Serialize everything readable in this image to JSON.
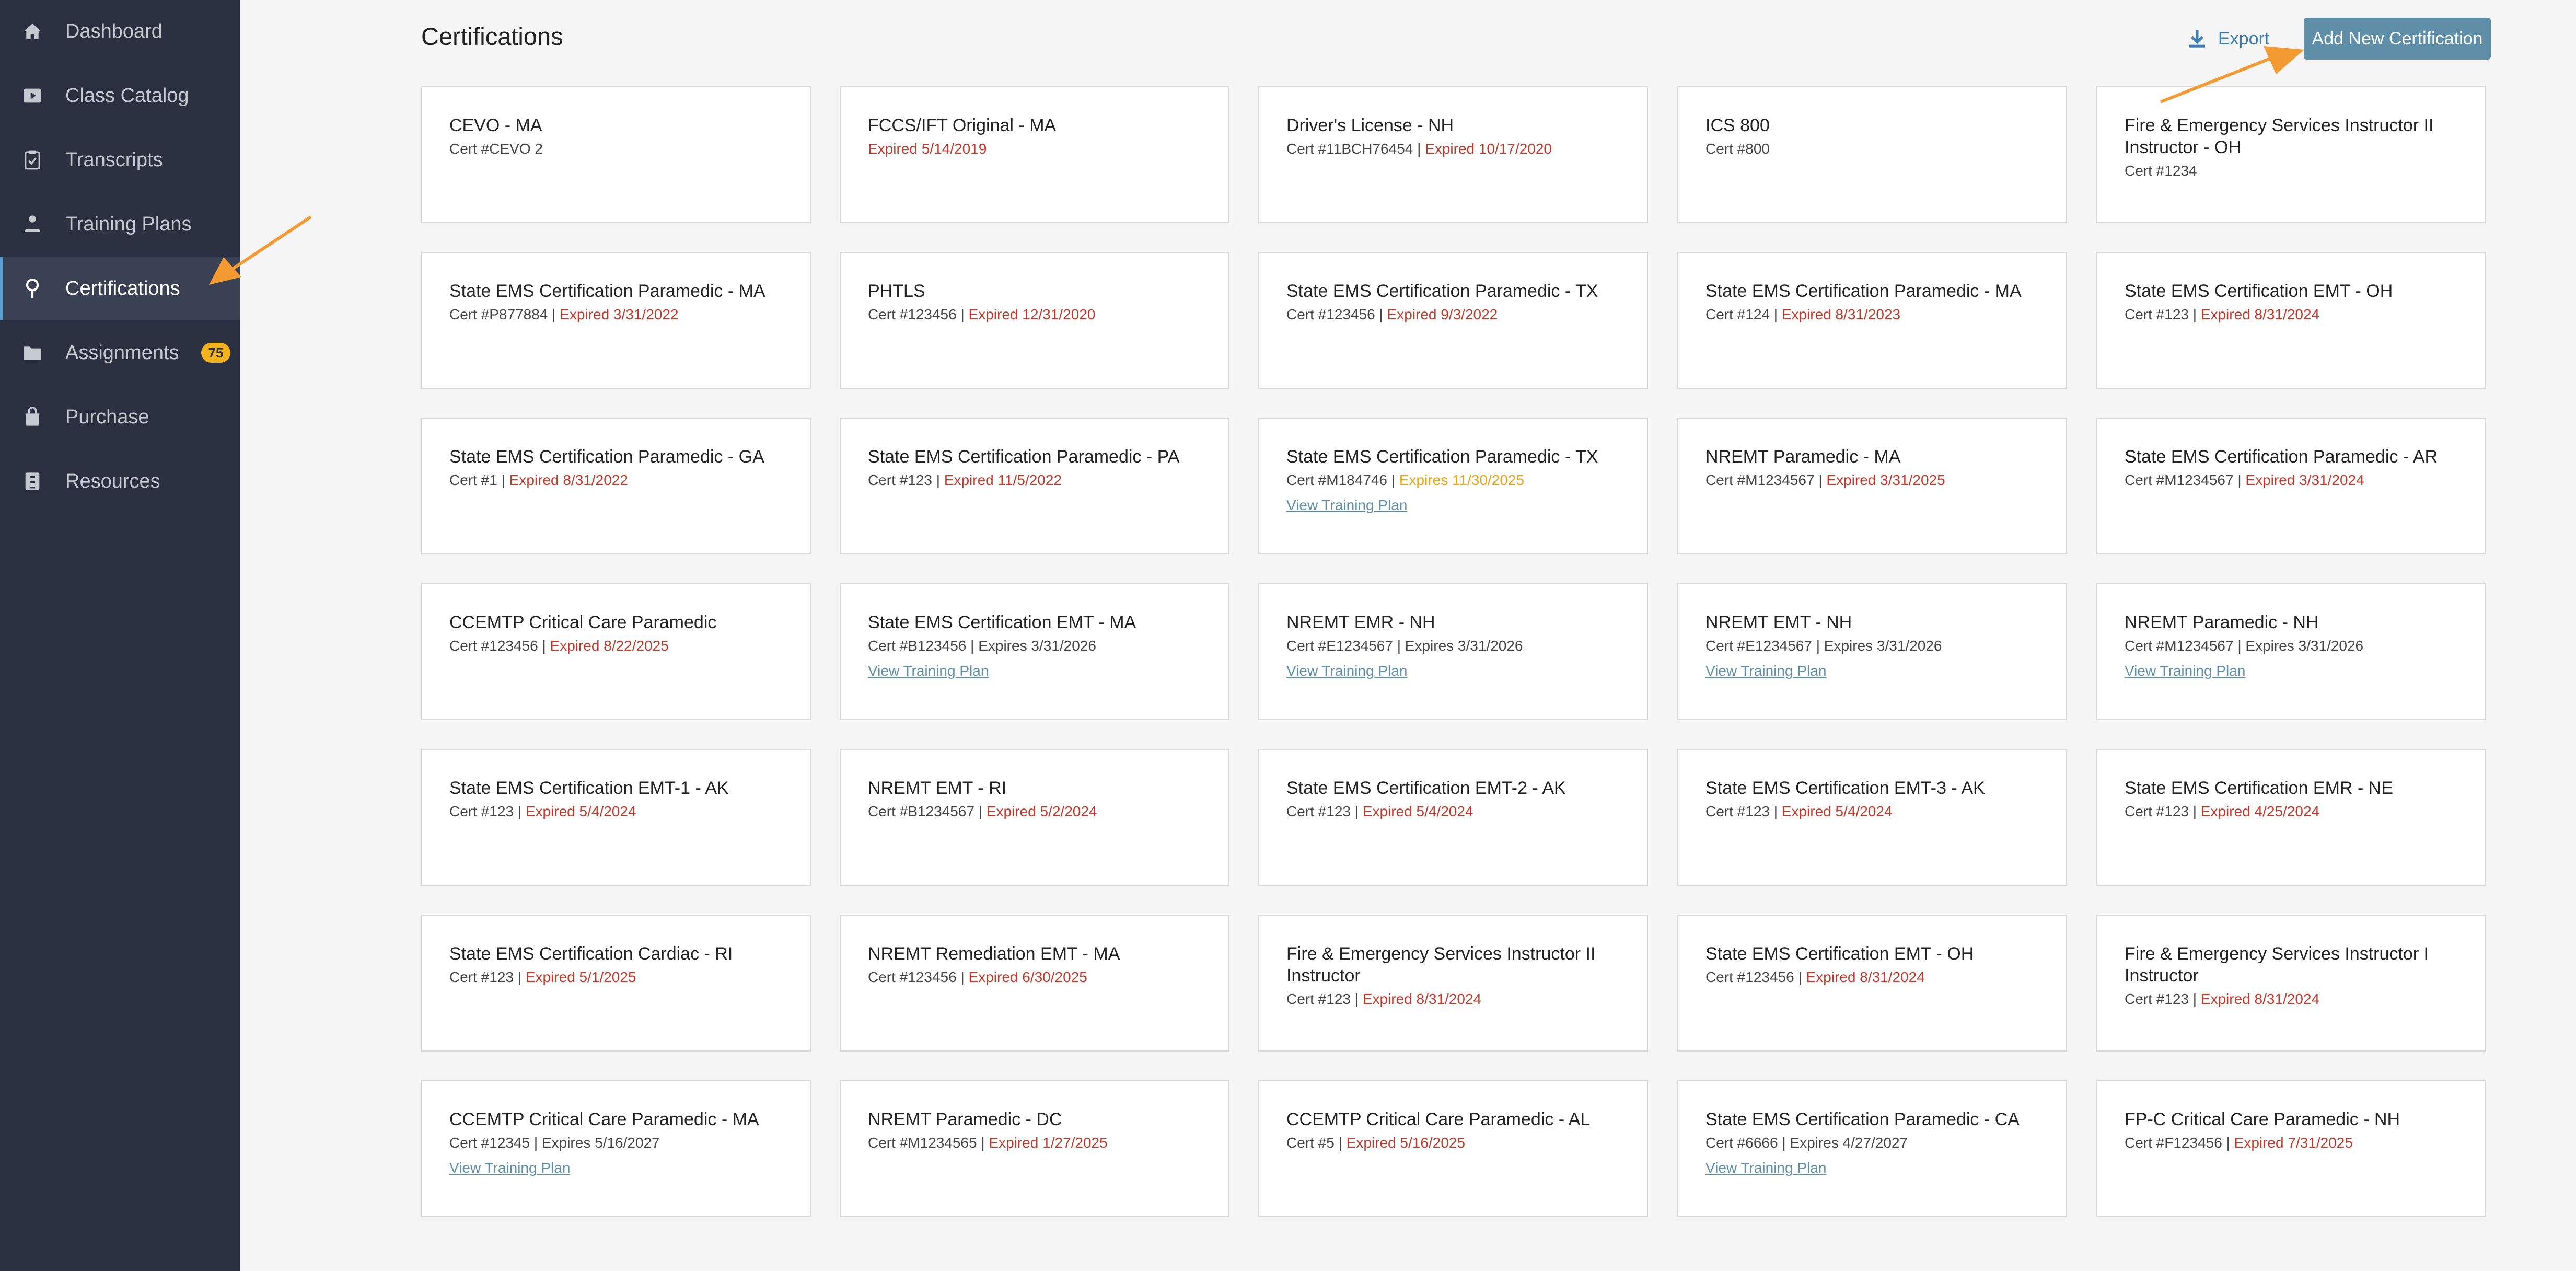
{
  "sidebar": {
    "items": [
      {
        "label": "Dashboard",
        "icon": "home-icon"
      },
      {
        "label": "Class Catalog",
        "icon": "play-icon"
      },
      {
        "label": "Transcripts",
        "icon": "clipboard-check-icon"
      },
      {
        "label": "Training Plans",
        "icon": "person-icon"
      },
      {
        "label": "Certifications",
        "icon": "ribbon-icon",
        "active": true
      },
      {
        "label": "Assignments",
        "icon": "folder-icon",
        "badge": "75"
      },
      {
        "label": "Purchase",
        "icon": "shopping-bag-icon"
      },
      {
        "label": "Resources",
        "icon": "cabinet-icon"
      }
    ]
  },
  "header": {
    "title": "Certifications",
    "export_label": "Export",
    "add_label": "Add New Certification"
  },
  "colors": {
    "sidebar_bg": "#2b3040",
    "active_item_bg": "#3a4152",
    "accent": "#5f8fa8",
    "expired": "#c0392b",
    "expiring_soon": "#e8a317",
    "badge": "#f2b21c",
    "annotation_arrow": "#f39a33"
  },
  "certifications": [
    {
      "title": "CEVO - MA",
      "cert": "Cert #CEVO 2",
      "status": "",
      "status_type": "none",
      "link": ""
    },
    {
      "title": "FCCS/IFT Original - MA",
      "cert": "",
      "status": "Expired 5/14/2019",
      "status_type": "expired",
      "link": ""
    },
    {
      "title": "Driver's License - NH",
      "cert": "Cert #11BCH76454",
      "status": "Expired 10/17/2020",
      "status_type": "expired",
      "link": ""
    },
    {
      "title": "ICS 800",
      "cert": "Cert #800",
      "status": "",
      "status_type": "none",
      "link": ""
    },
    {
      "title": "Fire & Emergency Services Instructor II Instructor - OH",
      "cert": "Cert #1234",
      "status": "",
      "status_type": "none",
      "link": ""
    },
    {
      "title": "State EMS Certification Paramedic - MA",
      "cert": "Cert #P877884",
      "status": "Expired 3/31/2022",
      "status_type": "expired",
      "link": ""
    },
    {
      "title": "PHTLS",
      "cert": "Cert #123456",
      "status": "Expired 12/31/2020",
      "status_type": "expired",
      "link": ""
    },
    {
      "title": "State EMS Certification Paramedic - TX",
      "cert": "Cert #123456",
      "status": "Expired 9/3/2022",
      "status_type": "expired",
      "link": ""
    },
    {
      "title": "State EMS Certification Paramedic - MA",
      "cert": "Cert #124",
      "status": "Expired 8/31/2023",
      "status_type": "expired",
      "link": ""
    },
    {
      "title": "State EMS Certification EMT - OH",
      "cert": "Cert #123",
      "status": "Expired 8/31/2024",
      "status_type": "expired",
      "link": ""
    },
    {
      "title": "State EMS Certification Paramedic - GA",
      "cert": "Cert #1",
      "status": "Expired 8/31/2022",
      "status_type": "expired",
      "link": ""
    },
    {
      "title": "State EMS Certification Paramedic - PA",
      "cert": "Cert #123",
      "status": "Expired 11/5/2022",
      "status_type": "expired",
      "link": ""
    },
    {
      "title": "State EMS Certification Paramedic - TX",
      "cert": "Cert #M184746",
      "status": "Expires 11/30/2025",
      "status_type": "soon",
      "link": "View Training Plan"
    },
    {
      "title": "NREMT Paramedic - MA",
      "cert": "Cert #M1234567",
      "status": "Expired 3/31/2025",
      "status_type": "expired",
      "link": ""
    },
    {
      "title": "State EMS Certification Paramedic - AR",
      "cert": "Cert #M1234567",
      "status": "Expired 3/31/2024",
      "status_type": "expired",
      "link": ""
    },
    {
      "title": "CCEMTP Critical Care Paramedic",
      "cert": "Cert #123456",
      "status": "Expired 8/22/2025",
      "status_type": "expired",
      "link": ""
    },
    {
      "title": "State EMS Certification EMT - MA",
      "cert": "Cert #B123456",
      "status": "Expires 3/31/2026",
      "status_type": "ok",
      "link": "View Training Plan"
    },
    {
      "title": "NREMT EMR - NH",
      "cert": "Cert #E1234567",
      "status": "Expires 3/31/2026",
      "status_type": "ok",
      "link": "View Training Plan"
    },
    {
      "title": "NREMT EMT - NH",
      "cert": "Cert #E1234567",
      "status": "Expires 3/31/2026",
      "status_type": "ok",
      "link": "View Training Plan"
    },
    {
      "title": "NREMT Paramedic - NH",
      "cert": "Cert #M1234567",
      "status": "Expires 3/31/2026",
      "status_type": "ok",
      "link": "View Training Plan"
    },
    {
      "title": "State EMS Certification EMT-1 - AK",
      "cert": "Cert #123",
      "status": "Expired 5/4/2024",
      "status_type": "expired",
      "link": ""
    },
    {
      "title": "NREMT EMT - RI",
      "cert": "Cert #B1234567",
      "status": "Expired 5/2/2024",
      "status_type": "expired",
      "link": ""
    },
    {
      "title": "State EMS Certification EMT-2 - AK",
      "cert": "Cert #123",
      "status": "Expired 5/4/2024",
      "status_type": "expired",
      "link": ""
    },
    {
      "title": "State EMS Certification EMT-3 - AK",
      "cert": "Cert #123",
      "status": "Expired 5/4/2024",
      "status_type": "expired",
      "link": ""
    },
    {
      "title": "State EMS Certification EMR - NE",
      "cert": "Cert #123",
      "status": "Expired 4/25/2024",
      "status_type": "expired",
      "link": ""
    },
    {
      "title": "State EMS Certification Cardiac - RI",
      "cert": "Cert #123",
      "status": "Expired 5/1/2025",
      "status_type": "expired",
      "link": ""
    },
    {
      "title": "NREMT Remediation EMT - MA",
      "cert": "Cert #123456",
      "status": "Expired 6/30/2025",
      "status_type": "expired",
      "link": ""
    },
    {
      "title": "Fire & Emergency Services Instructor II Instructor",
      "cert": "Cert #123",
      "status": "Expired 8/31/2024",
      "status_type": "expired",
      "link": ""
    },
    {
      "title": "State EMS Certification EMT - OH",
      "cert": "Cert #123456",
      "status": "Expired 8/31/2024",
      "status_type": "expired",
      "link": ""
    },
    {
      "title": "Fire & Emergency Services Instructor I Instructor",
      "cert": "Cert #123",
      "status": "Expired 8/31/2024",
      "status_type": "expired",
      "link": ""
    },
    {
      "title": "CCEMTP Critical Care Paramedic - MA",
      "cert": "Cert #12345",
      "status": "Expires 5/16/2027",
      "status_type": "ok",
      "link": "View Training Plan"
    },
    {
      "title": "NREMT Paramedic - DC",
      "cert": "Cert #M1234565",
      "status": "Expired 1/27/2025",
      "status_type": "expired",
      "link": ""
    },
    {
      "title": "CCEMTP Critical Care Paramedic - AL",
      "cert": "Cert #5",
      "status": "Expired 5/16/2025",
      "status_type": "expired",
      "link": ""
    },
    {
      "title": "State EMS Certification Paramedic - CA",
      "cert": "Cert #6666",
      "status": "Expires 4/27/2027",
      "status_type": "ok",
      "link": "View Training Plan"
    },
    {
      "title": "FP-C Critical Care Paramedic - NH",
      "cert": "Cert #F123456",
      "status": "Expired 7/31/2025",
      "status_type": "expired",
      "link": ""
    }
  ]
}
